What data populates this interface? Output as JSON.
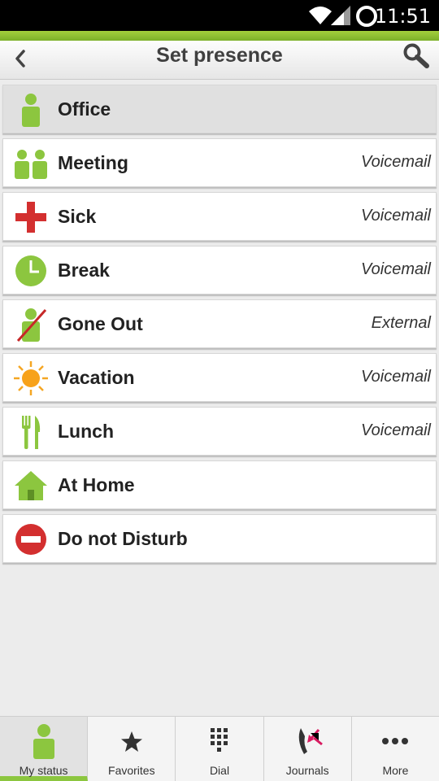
{
  "status_bar": {
    "time": "11:51"
  },
  "header": {
    "title": "Set presence"
  },
  "presence_list": [
    {
      "label": "Office",
      "forward": "",
      "icon": "person-icon",
      "selected": true
    },
    {
      "label": "Meeting",
      "forward": "Voicemail",
      "icon": "meeting-icon"
    },
    {
      "label": "Sick",
      "forward": "Voicemail",
      "icon": "red-cross-icon"
    },
    {
      "label": "Break",
      "forward": "Voicemail",
      "icon": "clock-icon"
    },
    {
      "label": "Gone Out",
      "forward": "External",
      "icon": "person-crossed-icon"
    },
    {
      "label": "Vacation",
      "forward": "Voicemail",
      "icon": "sun-icon"
    },
    {
      "label": "Lunch",
      "forward": "Voicemail",
      "icon": "fork-knife-icon"
    },
    {
      "label": "At Home",
      "forward": "",
      "icon": "house-icon"
    },
    {
      "label": "Do not Disturb",
      "forward": "",
      "icon": "no-entry-icon"
    }
  ],
  "tabs": [
    {
      "label": "My status",
      "icon": "person-icon",
      "active": true
    },
    {
      "label": "Favorites",
      "icon": "star-icon"
    },
    {
      "label": "Dial",
      "icon": "dialpad-icon"
    },
    {
      "label": "Journals",
      "icon": "phone-log-icon"
    },
    {
      "label": "More",
      "icon": "more-dots-icon"
    }
  ],
  "colors": {
    "accent": "#8cc63f",
    "green_icon": "#8cc63f",
    "red_icon": "#d32f2f",
    "status_bar": "#000000"
  }
}
